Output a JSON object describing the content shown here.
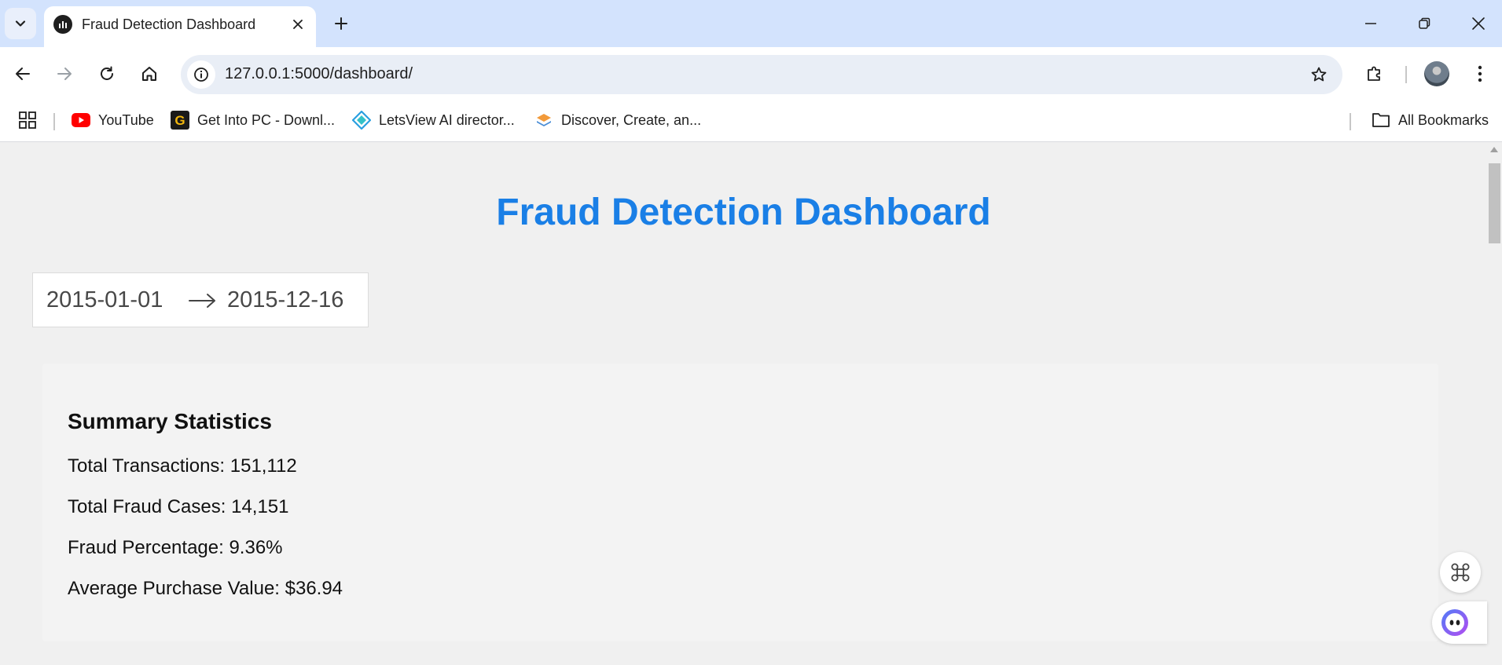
{
  "tab": {
    "title": "Fraud Detection Dashboard"
  },
  "toolbar": {
    "url": "127.0.0.1:5000/dashboard/"
  },
  "bookmarks": {
    "items": [
      {
        "label": "YouTube",
        "icon": "youtube-icon"
      },
      {
        "label": "Get Into PC - Downl...",
        "icon": "getintopc-icon"
      },
      {
        "label": "LetsView AI director...",
        "icon": "letsview-icon"
      },
      {
        "label": "Discover, Create, an...",
        "icon": "layers-icon"
      }
    ],
    "all_bookmarks": "All Bookmarks"
  },
  "page": {
    "title": "Fraud Detection Dashboard",
    "date_range": {
      "start": "2015-01-01",
      "end": "2015-12-16"
    },
    "summary": {
      "heading": "Summary Statistics",
      "stats": [
        "Total Transactions: 151,112",
        "Total Fraud Cases: 14,151",
        "Fraud Percentage: 9.36%",
        "Average Purchase Value: $36.94"
      ]
    }
  },
  "colors": {
    "title_blue": "#1a7fe6",
    "tabstrip": "#d3e3fd",
    "page_bg": "#f0f0f0"
  }
}
